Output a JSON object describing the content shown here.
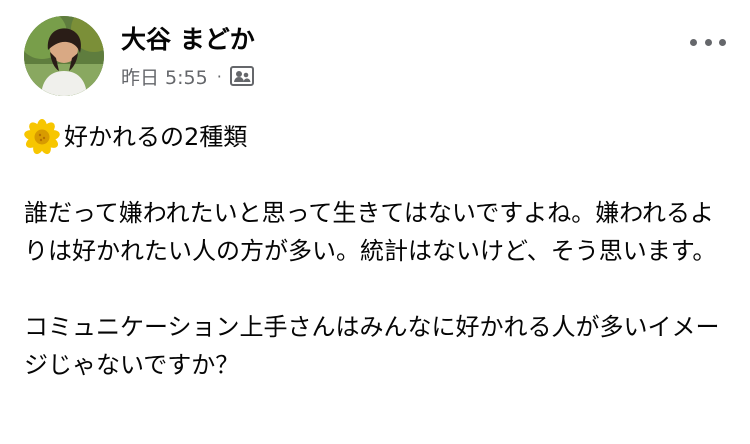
{
  "post": {
    "author": {
      "name": "大谷 まどか",
      "avatar": "avatar-photo"
    },
    "timestamp": "昨日 5:55",
    "separator": "·",
    "audience_icon": "group-icon",
    "more_icon": "more-options-icon",
    "title_emoji": "sunflower-icon",
    "title": "好かれるの2種類",
    "paragraphs": [
      "誰だって嫌われたいと思って生きてはないですよね。嫌われるよりは好かれたい人の方が多い。統計はないけど、そう思います。",
      "コミュニケーション上手さんはみんなに好かれる人が多いイメージじゃないですか？"
    ]
  },
  "colors": {
    "text_primary": "#050505",
    "text_secondary": "#65676b",
    "background": "#ffffff",
    "flower_petal": "#f7c600",
    "flower_center": "#d89b00"
  }
}
